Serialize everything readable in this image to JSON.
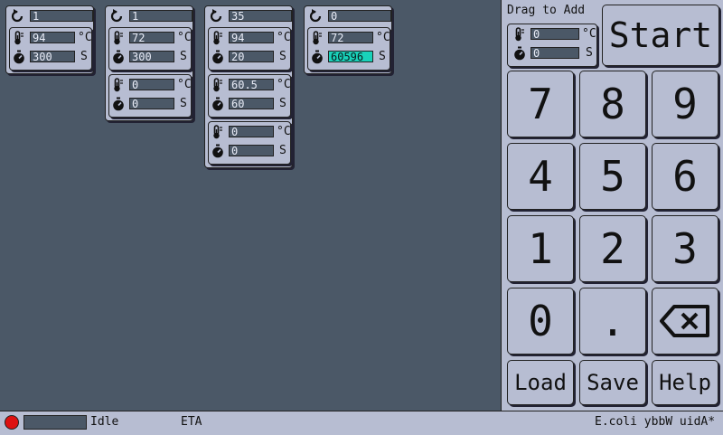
{
  "units": {
    "temp": "°C",
    "time": "S"
  },
  "programs": [
    {
      "repeat": "1",
      "steps": [
        {
          "temp": "94",
          "time": "300"
        }
      ]
    },
    {
      "repeat": "1",
      "steps": [
        {
          "temp": "72",
          "time": "300"
        },
        {
          "temp": "0",
          "time": "0"
        }
      ]
    },
    {
      "repeat": "35",
      "steps": [
        {
          "temp": "94",
          "time": "20"
        },
        {
          "temp": "60.5",
          "time": "60"
        },
        {
          "temp": "0",
          "time": "0"
        }
      ]
    },
    {
      "repeat": "0",
      "steps": [
        {
          "temp": "72",
          "time": "60596"
        }
      ]
    }
  ],
  "panel": {
    "drag_label": "Drag to Add",
    "template": {
      "temp": "0",
      "time": "0"
    },
    "start_label": "Start",
    "keys": [
      "7",
      "8",
      "9",
      "4",
      "5",
      "6",
      "1",
      "2",
      "3",
      "0",
      "."
    ],
    "load_label": "Load",
    "save_label": "Save",
    "help_label": "Help"
  },
  "status": {
    "state": "Idle",
    "eta_label": "ETA",
    "device": "E.coli ybbW uidA*",
    "progress": 0
  },
  "colors": {
    "background": "#4b5867",
    "panel": "#b7bdd2",
    "active_field": "#19d2ba",
    "led": "#dd1111"
  },
  "icons": [
    "repeat-icon",
    "thermometer-icon",
    "stopwatch-icon",
    "backspace-icon"
  ]
}
